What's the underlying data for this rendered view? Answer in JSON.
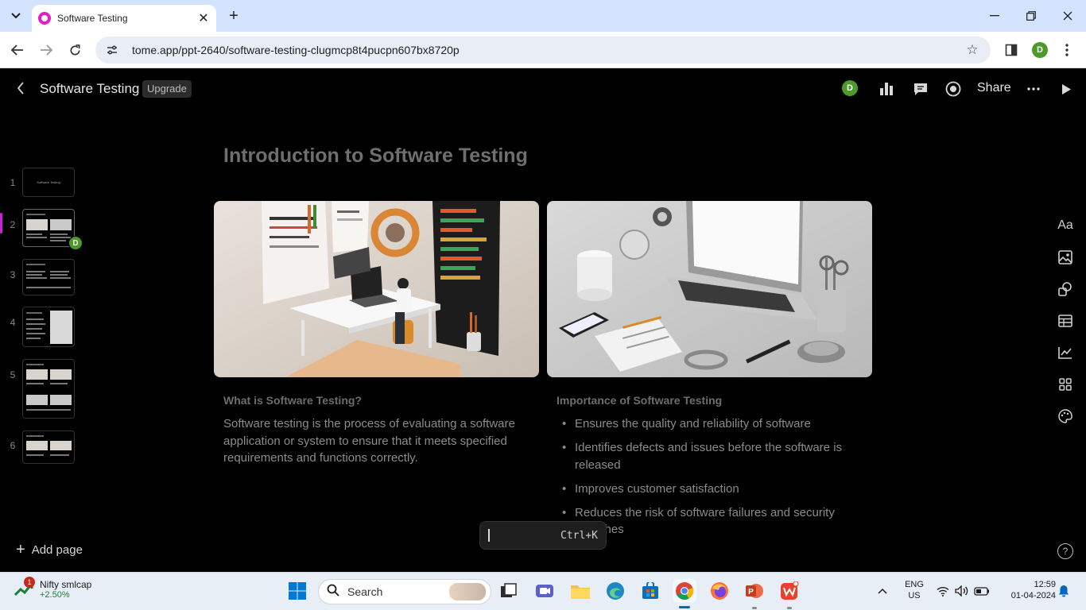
{
  "browser": {
    "tab_title": "Software Testing",
    "url": "tome.app/ppt-2640/software-testing-clugmcp8t4pucpn607bx8720p",
    "profile_initial": "D"
  },
  "app": {
    "doc_title": "Software Testing",
    "upgrade_label": "Upgrade",
    "share_label": "Share",
    "user_initial": "D",
    "add_page_label": "Add page",
    "command_shortcut": "Ctrl+K"
  },
  "thumbnails": [
    {
      "num": "1",
      "caption": "Software Testing"
    },
    {
      "num": "2"
    },
    {
      "num": "3"
    },
    {
      "num": "4"
    },
    {
      "num": "5"
    },
    {
      "num": "6"
    }
  ],
  "slide": {
    "title": "Introduction to Software Testing",
    "left": {
      "heading": "What is Software Testing?",
      "body": "Software testing is the process of evaluating a software application or system to ensure that it meets specified requirements and functions correctly."
    },
    "right": {
      "heading": "Importance of Software Testing",
      "bullets": [
        "Ensures the quality and reliability of software",
        "Identifies defects and issues before the software is released",
        "Improves customer satisfaction",
        "Reduces the risk of software failures and security breaches"
      ]
    }
  },
  "right_rail": {
    "text_tool_label": "Aa"
  },
  "taskbar": {
    "stock_name": "Nifty smlcap",
    "stock_change": "+2.50%",
    "stock_badge": "1",
    "search_label": "Search",
    "lang_line1": "ENG",
    "lang_line2": "US",
    "time": "12:59",
    "date": "01-04-2024"
  },
  "colors": {
    "accent": "#c724d6",
    "avatar": "#4c9a2a",
    "browser_tabbar": "#d3e3fd"
  }
}
